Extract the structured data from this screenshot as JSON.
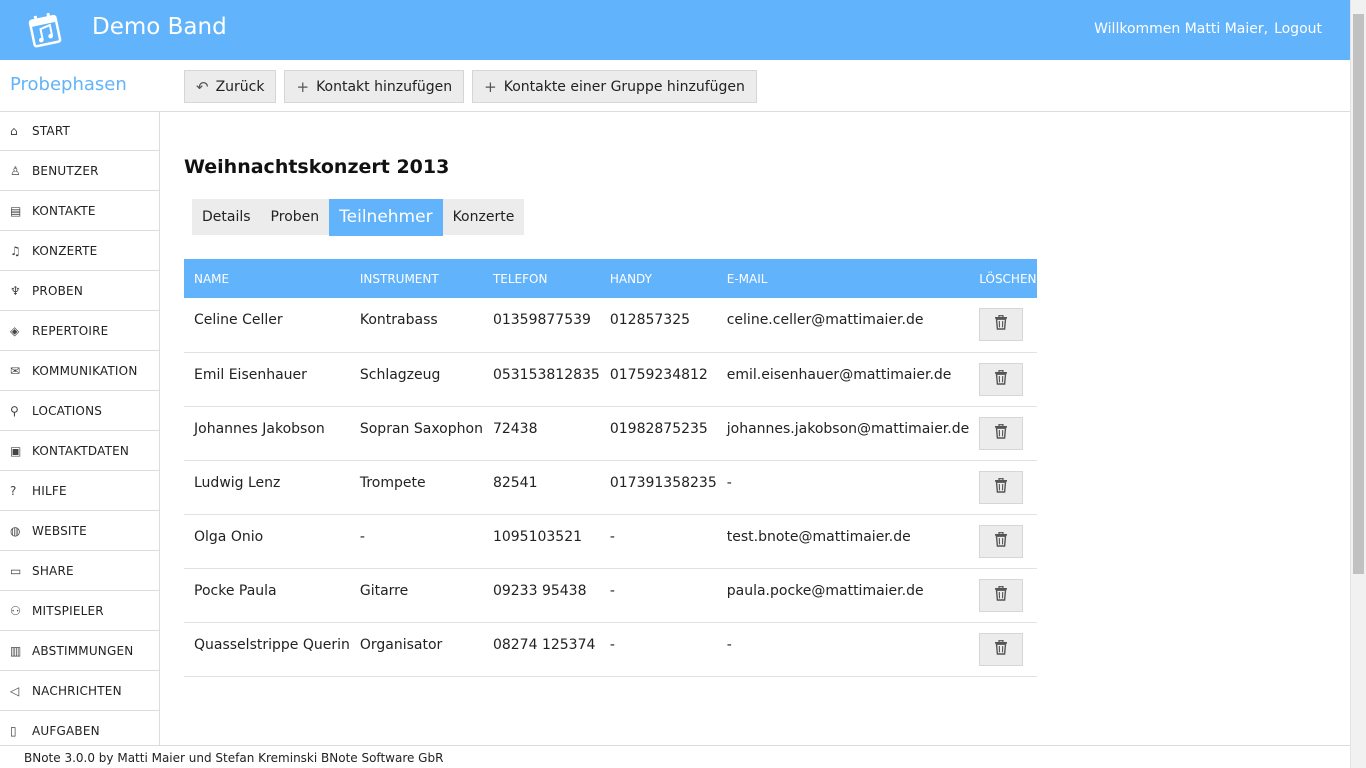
{
  "header": {
    "app_name": "Demo Band",
    "welcome": "Willkommen Matti Maier,",
    "logout": "Logout",
    "brand_color": "#61b3fb"
  },
  "module_title": "Probephasen",
  "toolbar": {
    "back": "Zurück",
    "add_contact": "Kontakt hinzufügen",
    "add_group": "Kontakte einer Gruppe hinzufügen"
  },
  "sidebar": {
    "items": [
      {
        "label": "START",
        "icon": "home-icon"
      },
      {
        "label": "BENUTZER",
        "icon": "users-icon"
      },
      {
        "label": "KONTAKTE",
        "icon": "contact-card-icon"
      },
      {
        "label": "KONZERTE",
        "icon": "concert-icon"
      },
      {
        "label": "PROBEN",
        "icon": "rehearsal-icon"
      },
      {
        "label": "REPERTOIRE",
        "icon": "repertoire-icon"
      },
      {
        "label": "KOMMUNIKATION",
        "icon": "envelope-icon"
      },
      {
        "label": "LOCATIONS",
        "icon": "map-pin-icon"
      },
      {
        "label": "KONTAKTDATEN",
        "icon": "contact-data-icon"
      },
      {
        "label": "HILFE",
        "icon": "help-icon"
      },
      {
        "label": "WEBSITE",
        "icon": "globe-icon"
      },
      {
        "label": "SHARE",
        "icon": "share-icon"
      },
      {
        "label": "MITSPIELER",
        "icon": "team-icon"
      },
      {
        "label": "ABSTIMMUNGEN",
        "icon": "bar-chart-icon"
      },
      {
        "label": "NACHRICHTEN",
        "icon": "megaphone-icon"
      },
      {
        "label": "AUFGABEN",
        "icon": "task-icon"
      }
    ]
  },
  "page": {
    "title": "Weihnachtskonzert 2013",
    "tabs": [
      "Details",
      "Proben",
      "Teilnehmer",
      "Konzerte"
    ],
    "active_tab": "Teilnehmer"
  },
  "table": {
    "columns": [
      "NAME",
      "INSTRUMENT",
      "TELEFON",
      "HANDY",
      "E-MAIL",
      "LÖSCHEN"
    ],
    "rows": [
      [
        "Celine Celler",
        "Kontrabass",
        "01359877539",
        "012857325",
        "celine.celler@mattimaier.de"
      ],
      [
        "Emil Eisenhauer",
        "Schlagzeug",
        "053153812835",
        "01759234812",
        "emil.eisenhauer@mattimaier.de"
      ],
      [
        "Johannes Jakobson",
        "Sopran Saxophon",
        "72438",
        "01982875235",
        "johannes.jakobson@mattimaier.de"
      ],
      [
        "Ludwig Lenz",
        "Trompete",
        "82541",
        "017391358235",
        "-"
      ],
      [
        "Olga Onio",
        "-",
        "1095103521",
        "-",
        "test.bnote@mattimaier.de"
      ],
      [
        "Pocke Paula",
        "Gitarre",
        "09233 95438",
        "-",
        "paula.pocke@mattimaier.de"
      ],
      [
        "Quasselstrippe Querin",
        "Organisator",
        "08274 125374",
        "-",
        "-"
      ]
    ]
  },
  "footer": "BNote 3.0.0 by Matti Maier und Stefan Kreminski BNote Software GbR"
}
